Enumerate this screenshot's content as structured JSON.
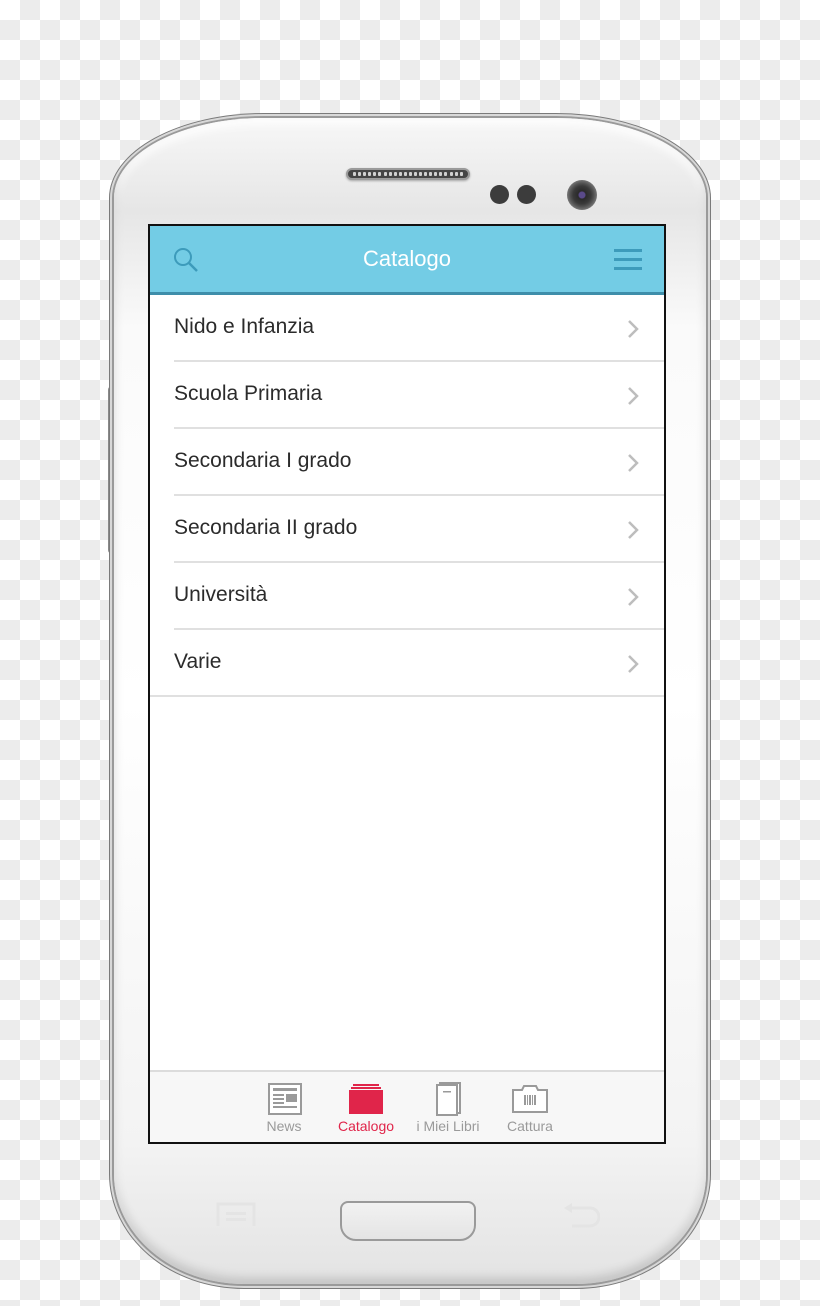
{
  "app": {
    "title": "Catalogo",
    "header_icons": {
      "left": "search-icon",
      "right": "hamburger-menu-icon"
    },
    "colors": {
      "header": "#73cce5",
      "header_border": "#3e8eaa",
      "active_tab": "#e0254a",
      "inactive_tab": "#9a9a9a"
    }
  },
  "list": {
    "items": [
      {
        "label": "Nido e Infanzia",
        "icon": "chevron-right-icon"
      },
      {
        "label": "Scuola Primaria",
        "icon": "chevron-right-icon"
      },
      {
        "label": "Secondaria I grado",
        "icon": "chevron-right-icon"
      },
      {
        "label": "Secondaria II grado",
        "icon": "chevron-right-icon"
      },
      {
        "label": "Università",
        "icon": "chevron-right-icon"
      },
      {
        "label": "Varie",
        "icon": "chevron-right-icon"
      }
    ]
  },
  "tabbar": {
    "active": "Catalogo",
    "tabs": [
      {
        "label": "News",
        "icon": "newspaper-icon"
      },
      {
        "label": "Catalogo",
        "icon": "stacked-folder-icon"
      },
      {
        "label": "i Miei Libri",
        "icon": "book-icon"
      },
      {
        "label": "Cattura",
        "icon": "barcode-camera-icon"
      }
    ]
  },
  "device": {
    "hardware_buttons": [
      "menu-key",
      "home-button",
      "back-key"
    ]
  }
}
